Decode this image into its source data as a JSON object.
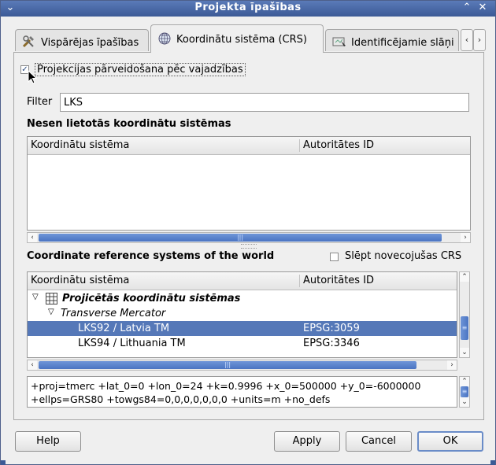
{
  "window": {
    "title": "Projekta īpašības"
  },
  "tabs": [
    {
      "label": "Vispārējas īpašības",
      "icon": "tools-icon"
    },
    {
      "label": "Koordinātu sistēma (CRS)",
      "icon": "globe-icon"
    },
    {
      "label": "Identificējamie slāņi",
      "icon": "identify-icon"
    }
  ],
  "projection": {
    "checkbox_label": "Projekcijas pārveidošana pēc vajadzības",
    "checked": true
  },
  "filter": {
    "label": "Filter",
    "value": "LKS"
  },
  "recent": {
    "heading": "Nesen lietotās koordinātu sistēmas",
    "columns": [
      "Koordinātu sistēma",
      "Autoritātes ID"
    ]
  },
  "world": {
    "heading": "Coordinate reference systems of the world",
    "hide_label": "Slēpt novecojušas CRS",
    "columns": [
      "Koordinātu sistēma",
      "Autoritātes ID"
    ],
    "group": "Projicētās koordinātu sistēmas",
    "subgroup": "Transverse Mercator",
    "rows": [
      {
        "name": "LKS92 / Latvia TM",
        "id": "EPSG:3059",
        "selected": true
      },
      {
        "name": "LKS94 / Lithuania TM",
        "id": "EPSG:3346",
        "selected": false
      }
    ]
  },
  "proj_string": {
    "line1": "+proj=tmerc +lat_0=0 +lon_0=24 +k=0.9996 +x_0=500000 +y_0=-6000000",
    "line2": "+ellps=GRS80 +towgs84=0,0,0,0,0,0,0 +units=m +no_defs"
  },
  "buttons": {
    "help": "Help",
    "apply": "Apply",
    "cancel": "Cancel",
    "ok": "OK"
  },
  "colors": {
    "titlebar": "#3c5a96",
    "selection": "#5578b8",
    "scroll_thumb": "#4a74c2"
  }
}
